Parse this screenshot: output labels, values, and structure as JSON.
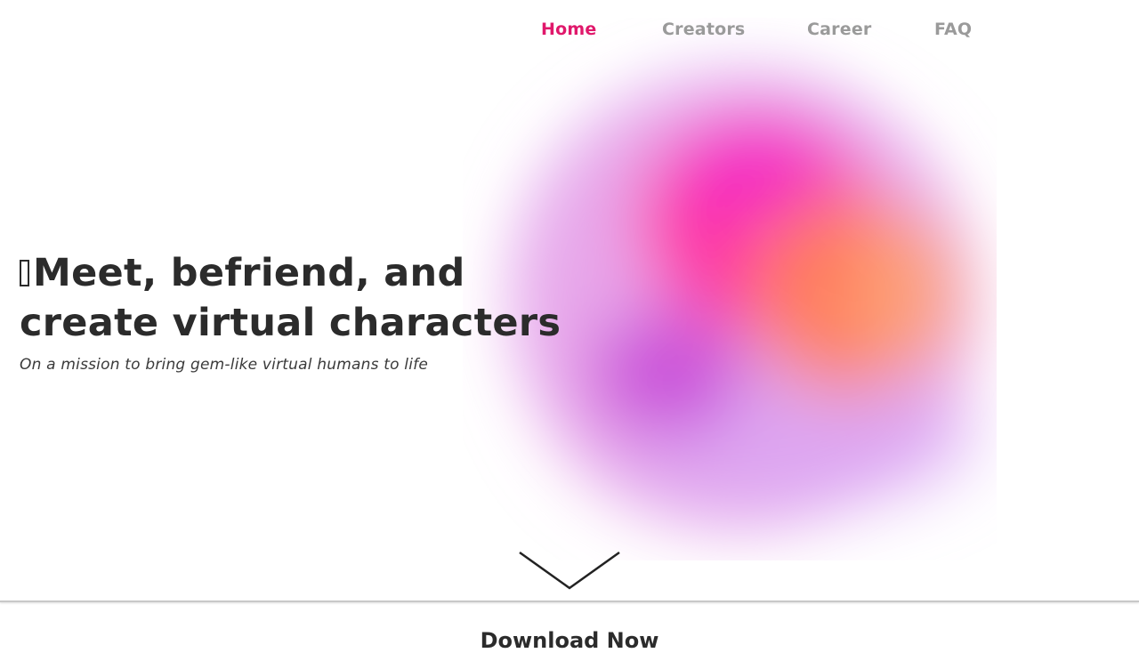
{
  "nav": {
    "items": [
      {
        "label": "Home",
        "active": true
      },
      {
        "label": "Creators",
        "active": false
      },
      {
        "label": "Career",
        "active": false
      },
      {
        "label": "FAQ",
        "active": false
      }
    ]
  },
  "hero": {
    "title_line1": "Meet, befriend, and",
    "title_line2": "create virtual characters",
    "subtitle": "On a mission to bring gem-like virtual humans to life"
  },
  "download": {
    "label": "Download Now"
  },
  "icons": {
    "scroll": "chevron-down-icon",
    "title_glyph": "missing-glyph-box-icon"
  },
  "colors": {
    "accent": "#e0186b",
    "nav_inactive": "#9a9a9a",
    "text": "#2b2b2b"
  }
}
